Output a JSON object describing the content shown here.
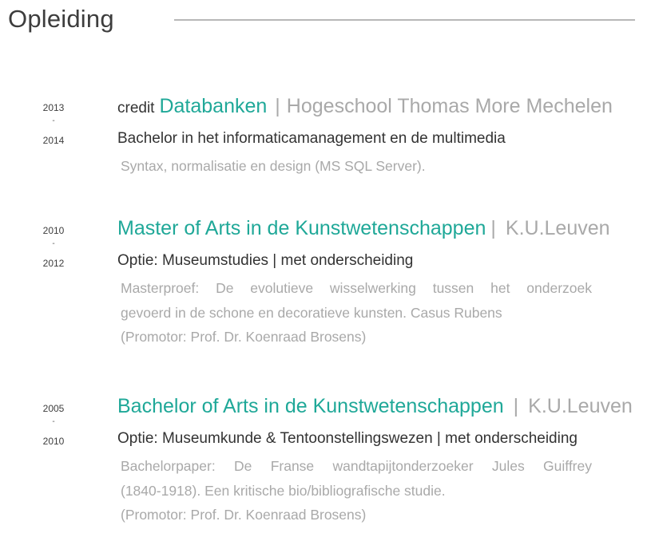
{
  "section": {
    "title": "Opleiding"
  },
  "entries": [
    {
      "year_start": "2013",
      "year_sep": "-",
      "year_end": "2014",
      "title_prefix": "credit",
      "title": "Databanken",
      "title_sep": "|",
      "institution": "Hogeschool Thomas More Mechelen",
      "subtitle": "Bachelor in het informaticamanagement en de multimedia",
      "desc_lines": [
        "Syntax, normalisatie en design (MS SQL Server)."
      ]
    },
    {
      "year_start": "2010",
      "year_sep": "-",
      "year_end": "2012",
      "title": "Master of Arts in de Kunstwetenschappen",
      "title_sep": "|",
      "institution": "K.U.Leuven",
      "subtitle": "Optie: Museumstudies | met onderscheiding",
      "desc_lines": [
        "Masterproef: De evolutieve wisselwerking tussen het onderzoek",
        "gevoerd in  de schone en decoratieve kunsten. Casus Rubens",
        "(Promotor: Prof. Dr. Koenraad  Brosens)"
      ]
    },
    {
      "year_start": "2005",
      "year_sep": "-",
      "year_end": "2010",
      "title": "Bachelor of Arts in de Kunstwetenschappen",
      "title_sep": "|",
      "institution": "K.U.Leuven",
      "subtitle": "Optie: Museumkunde & Tentoonstellingswezen | met onderscheiding",
      "desc_lines": [
        "Bachelorpaper: De Franse wandtapijtonderzoeker Jules Guiffrey",
        "(1840-1918). Een kritische bio/bibliografische studie.",
        "(Promotor: Prof. Dr. Koenraad Brosens)"
      ]
    }
  ]
}
